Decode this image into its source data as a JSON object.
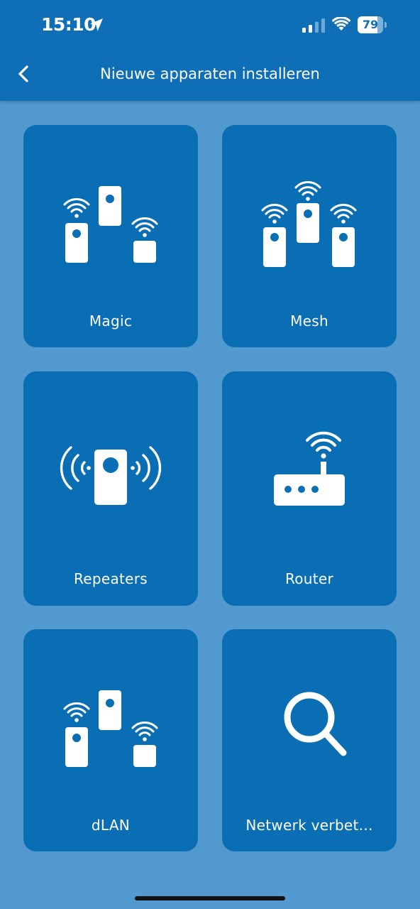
{
  "status_bar": {
    "time": "15:10",
    "battery_percent": "79",
    "battery_level": 0.79,
    "signal_bars_filled": 2,
    "signal_bars_total": 4,
    "icons": [
      "location-arrow-icon",
      "cellular-signal-icon",
      "wifi-icon",
      "battery-icon"
    ]
  },
  "header": {
    "title": "Nieuwe apparaten installeren",
    "back_icon": "chevron-left-icon"
  },
  "tiles": [
    {
      "label": "Magic",
      "icon": "magic-devices-icon"
    },
    {
      "label": "Mesh",
      "icon": "mesh-devices-icon"
    },
    {
      "label": "Repeaters",
      "icon": "repeater-icon"
    },
    {
      "label": "Router",
      "icon": "router-icon"
    },
    {
      "label": "dLAN",
      "icon": "dlan-devices-icon"
    },
    {
      "label": "Netwerk verbet...",
      "icon": "search-icon"
    }
  ],
  "colors": {
    "background": "#5299cf",
    "header": "#0f6fb6",
    "tile": "#0a6eb4",
    "foreground": "#ffffff"
  }
}
